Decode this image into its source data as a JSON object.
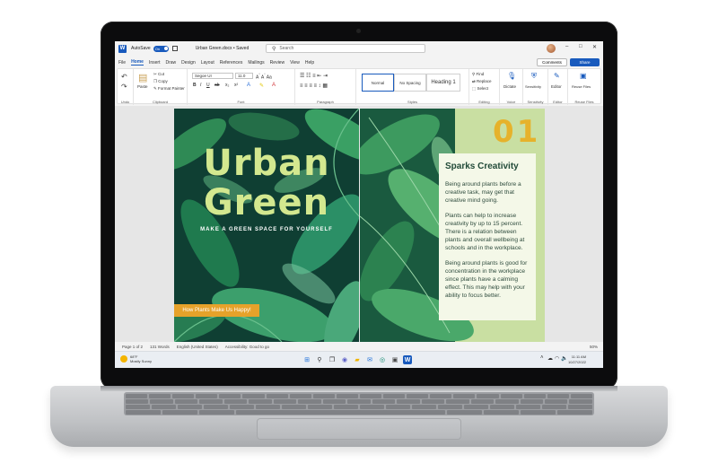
{
  "titlebar": {
    "autosave_label": "AutoSave",
    "autosave_state": "On",
    "document_title": "Urban Green.docx • Saved",
    "search_placeholder": "Search"
  },
  "menu": {
    "tabs": [
      "File",
      "Home",
      "Insert",
      "Draw",
      "Design",
      "Layout",
      "References",
      "Mailings",
      "Review",
      "View",
      "Help"
    ],
    "active_tab": "Home",
    "comments_label": "Comments",
    "share_label": "Share"
  },
  "ribbon": {
    "undo_group": "Undo",
    "clipboard": {
      "label": "Clipboard",
      "paste": "Paste",
      "cut": "Cut",
      "copy": "Copy",
      "format_painter": "Format Painter"
    },
    "font": {
      "label": "Font",
      "family": "Segoe UI",
      "size": "11.0"
    },
    "paragraph_label": "Paragraph",
    "styles": {
      "label": "Styles",
      "items": [
        "Normal",
        "No Spacing",
        "Heading 1"
      ]
    },
    "editing": {
      "label": "Editing",
      "find": "Find",
      "replace": "Replace",
      "select": "Select"
    },
    "voice": {
      "label": "Voice",
      "dictate": "Dictate"
    },
    "sensitivity": {
      "label": "Sensitivity",
      "button": "Sensitivity"
    },
    "editor": {
      "label": "Editor",
      "button": "Editor"
    },
    "reuse": {
      "label": "Reuse Files",
      "button": "Reuse Files"
    }
  },
  "document": {
    "left_page": {
      "title_line1": "Urban",
      "title_line2": "Green",
      "tagline": "MAKE A GREEN SPACE FOR YOURSELF",
      "cta": "How Plants Make Us Happy!"
    },
    "right_page": {
      "number": "01",
      "heading": "Sparks Creativity",
      "paragraphs": [
        "Being around plants before a creative task, may get that creative mind going.",
        "Plants can help to increase creativity by up to 15 percent. There is a relation between plants and overall wellbeing at schools and in the workplace.",
        "Being around plants is good for concentration in the workplace since plants have a calming effect. This may help with your ability to focus better."
      ]
    }
  },
  "statusbar": {
    "page": "Page 1 of 2",
    "words": "131 Words",
    "language": "English (United States)",
    "accessibility": "Accessibility: Good to go",
    "zoom": "50%"
  },
  "taskbar": {
    "weather_temp": "68°F",
    "weather_desc": "Mostly Sunny",
    "time": "11:11 AM",
    "date": "10/27/2022"
  },
  "colors": {
    "accent": "#185abd",
    "title_green": "#d3e88f",
    "cta_orange": "#e6a22a",
    "number_gold": "#e6b22b",
    "panel_green": "#c9dfa2"
  }
}
